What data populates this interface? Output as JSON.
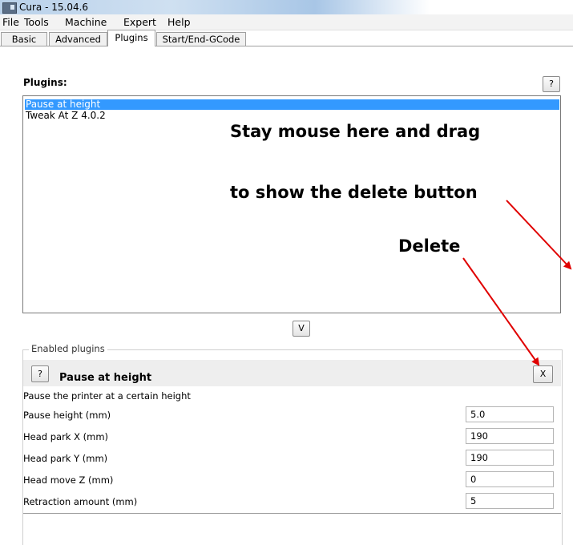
{
  "window": {
    "title": "Cura - 15.04.6"
  },
  "menu": [
    "File",
    "Tools",
    "Machine",
    "Expert",
    "Help"
  ],
  "tabs": [
    "Basic",
    "Advanced",
    "Plugins",
    "Start/End-GCode"
  ],
  "active_tab": "Plugins",
  "plugins_panel": {
    "label": "Plugins:",
    "help_label": "?",
    "items": [
      "Pause at height",
      "Tweak At Z 4.0.2"
    ],
    "selected": "Pause at height",
    "add_button_label": "V"
  },
  "annotations": {
    "line1": "Stay mouse here and drag",
    "line2": "to show the delete button",
    "delete": "Delete",
    "arrow_color": "#e00000"
  },
  "enabled_plugins": {
    "group_label": "Enabled plugins",
    "help_label": "?",
    "name": "Pause at height",
    "delete_label": "X",
    "description": "Pause the printer at a certain height",
    "settings": [
      {
        "label": "Pause height (mm)",
        "value": "5.0"
      },
      {
        "label": "Head park X (mm)",
        "value": "190"
      },
      {
        "label": "Head park Y (mm)",
        "value": "190"
      },
      {
        "label": "Head move Z (mm)",
        "value": "0"
      },
      {
        "label": "Retraction amount (mm)",
        "value": "5"
      }
    ]
  },
  "colors": {
    "selection": "#3399ff",
    "accent_arrow": "#e00000"
  }
}
